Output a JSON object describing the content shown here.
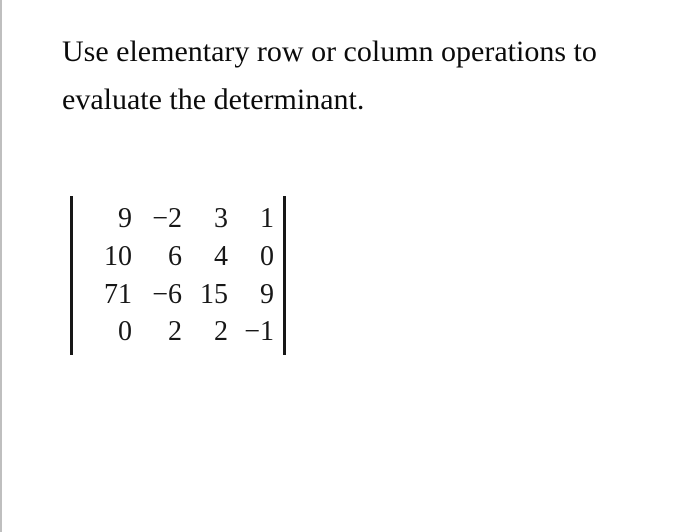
{
  "instruction": {
    "line1": "Use elementary row or column operations to",
    "line2": "evaluate the determinant."
  },
  "matrix": {
    "rows": [
      {
        "c1": "9",
        "c2": "−2",
        "c3": "3",
        "c4": "1"
      },
      {
        "c1": "10",
        "c2": "6",
        "c3": "4",
        "c4": "0"
      },
      {
        "c1": "71",
        "c2": "−6",
        "c3": "15",
        "c4": "9"
      },
      {
        "c1": "0",
        "c2": "2",
        "c3": "2",
        "c4": "−1"
      }
    ]
  }
}
